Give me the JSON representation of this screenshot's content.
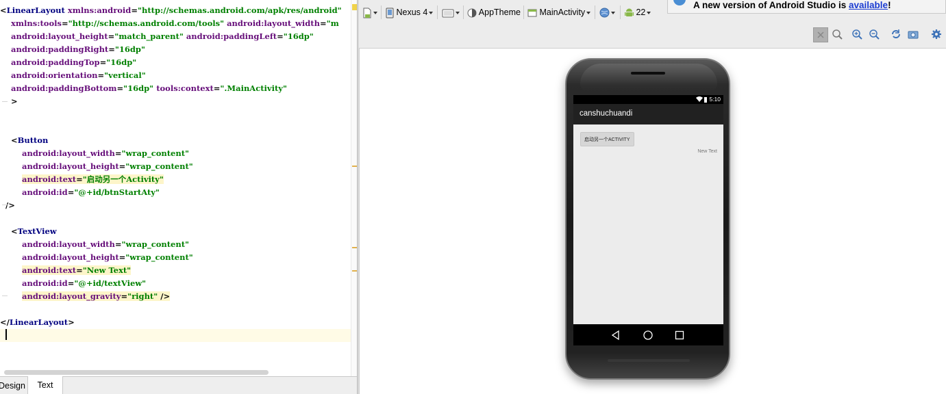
{
  "editor": {
    "lines": [
      {
        "indent": "",
        "parts": [
          [
            "punct",
            "<"
          ],
          [
            "tag",
            "LinearLayout"
          ],
          [
            "punct",
            " "
          ],
          [
            "attr",
            "xmlns:android"
          ],
          [
            "punct",
            "="
          ],
          [
            "str",
            "\"http://schemas.android.com/apk/res/android\""
          ]
        ]
      },
      {
        "indent": "    ",
        "parts": [
          [
            "attr",
            "xmlns:tools"
          ],
          [
            "punct",
            "="
          ],
          [
            "str",
            "\"http://schemas.android.com/tools\""
          ],
          [
            "punct",
            " "
          ],
          [
            "attr",
            "android:layout_width"
          ],
          [
            "punct",
            "="
          ],
          [
            "str",
            "\"m"
          ]
        ]
      },
      {
        "indent": "    ",
        "parts": [
          [
            "attr",
            "android:layout_height"
          ],
          [
            "punct",
            "="
          ],
          [
            "str",
            "\"match_parent\""
          ],
          [
            "punct",
            " "
          ],
          [
            "attr",
            "android:paddingLeft"
          ],
          [
            "punct",
            "="
          ],
          [
            "str",
            "\"16dp\""
          ]
        ]
      },
      {
        "indent": "    ",
        "parts": [
          [
            "attr",
            "android:paddingRight"
          ],
          [
            "punct",
            "="
          ],
          [
            "str",
            "\"16dp\""
          ]
        ]
      },
      {
        "indent": "    ",
        "parts": [
          [
            "attr",
            "android:paddingTop"
          ],
          [
            "punct",
            "="
          ],
          [
            "str",
            "\"16dp\""
          ]
        ]
      },
      {
        "indent": "    ",
        "parts": [
          [
            "attr",
            "android:orientation"
          ],
          [
            "punct",
            "="
          ],
          [
            "str",
            "\"vertical\""
          ]
        ]
      },
      {
        "indent": "    ",
        "parts": [
          [
            "attr",
            "android:paddingBottom"
          ],
          [
            "punct",
            "="
          ],
          [
            "str",
            "\"16dp\""
          ],
          [
            "punct",
            " "
          ],
          [
            "attr",
            "tools:context"
          ],
          [
            "punct",
            "="
          ],
          [
            "str",
            "\".MainActivity\""
          ]
        ]
      },
      {
        "indent": "    ",
        "parts": [
          [
            "punct",
            ">"
          ]
        ]
      },
      {
        "indent": "",
        "parts": []
      },
      {
        "indent": "",
        "parts": []
      },
      {
        "indent": "    ",
        "parts": [
          [
            "punct",
            "<"
          ],
          [
            "tag",
            "Button"
          ]
        ]
      },
      {
        "indent": "        ",
        "parts": [
          [
            "attr",
            "android:layout_width"
          ],
          [
            "punct",
            "="
          ],
          [
            "str",
            "\"wrap_content\""
          ]
        ]
      },
      {
        "indent": "        ",
        "parts": [
          [
            "attr",
            "android:layout_height"
          ],
          [
            "punct",
            "="
          ],
          [
            "str",
            "\"wrap_content\""
          ]
        ]
      },
      {
        "indent": "        ",
        "hl": true,
        "parts": [
          [
            "attr",
            "android:text"
          ],
          [
            "punct",
            "="
          ],
          [
            "str",
            "\"启动另一个Activity\""
          ]
        ]
      },
      {
        "indent": "        ",
        "parts": [
          [
            "attr",
            "android:id"
          ],
          [
            "punct",
            "="
          ],
          [
            "str",
            "\"@+id/btnStartAty\""
          ]
        ]
      },
      {
        "indent": "  ",
        "parts": [
          [
            "punct",
            "/>"
          ]
        ]
      },
      {
        "indent": "",
        "parts": []
      },
      {
        "indent": "    ",
        "parts": [
          [
            "punct",
            "<"
          ],
          [
            "tag",
            "TextView"
          ]
        ]
      },
      {
        "indent": "        ",
        "parts": [
          [
            "attr",
            "android:layout_width"
          ],
          [
            "punct",
            "="
          ],
          [
            "str",
            "\"wrap_content\""
          ]
        ]
      },
      {
        "indent": "        ",
        "parts": [
          [
            "attr",
            "android:layout_height"
          ],
          [
            "punct",
            "="
          ],
          [
            "str",
            "\"wrap_content\""
          ]
        ]
      },
      {
        "indent": "        ",
        "hl": true,
        "parts": [
          [
            "attr",
            "android:text"
          ],
          [
            "punct",
            "="
          ],
          [
            "str",
            "\"New Text\""
          ]
        ]
      },
      {
        "indent": "        ",
        "parts": [
          [
            "attr",
            "android:id"
          ],
          [
            "punct",
            "="
          ],
          [
            "str",
            "\"@+id/textView\""
          ]
        ]
      },
      {
        "indent": "        ",
        "hl": true,
        "parts": [
          [
            "attr",
            "android:layout_gravity"
          ],
          [
            "punct",
            "="
          ],
          [
            "str",
            "\"right\""
          ],
          [
            "punct",
            " />"
          ]
        ]
      },
      {
        "indent": "",
        "parts": []
      },
      {
        "indent": "",
        "parts": [
          [
            "punct",
            "</"
          ],
          [
            "tag",
            "LinearLayout"
          ],
          [
            "punct",
            ">"
          ]
        ]
      },
      {
        "indent": "",
        "current": true,
        "parts": []
      }
    ],
    "tabs": {
      "design": "Design",
      "text": "Text"
    }
  },
  "toolbar": {
    "device": "Nexus 4",
    "theme": "AppTheme",
    "activity": "MainActivity",
    "api": "22"
  },
  "notification": {
    "text": "A new version of Android Studio is ",
    "link": "available",
    "suffix": "!"
  },
  "phone": {
    "time": "5:10",
    "app_title": "canshuchuandi",
    "button_label": "启动另一个ACTIVITY",
    "text_view": "New Text"
  },
  "colors": {
    "tag": "#000080",
    "attr": "#660e7a",
    "string": "#008000",
    "action_bar": "#212121",
    "content_bg": "#ececec"
  }
}
